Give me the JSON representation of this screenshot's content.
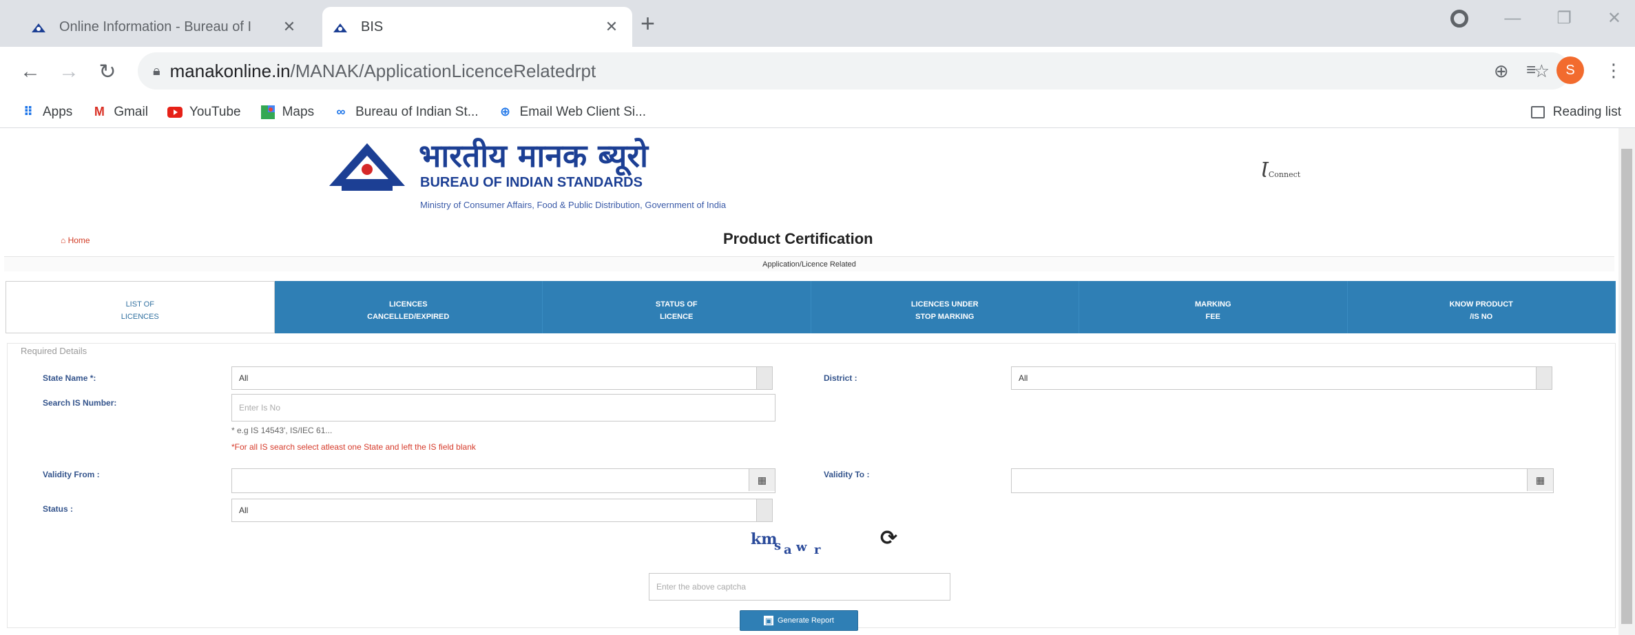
{
  "browser": {
    "tabs": [
      {
        "title": "Online Information - Bureau of I",
        "active": false
      },
      {
        "title": "BIS",
        "active": true
      }
    ],
    "url": {
      "host": "manakonline.in",
      "path": "/MANAK/ApplicationLicenceRelatedrpt"
    },
    "avatar_initial": "S",
    "bookmarks": [
      {
        "label": "Apps",
        "icon": "apps-grid-icon"
      },
      {
        "label": "Gmail",
        "icon": "gmail-icon"
      },
      {
        "label": "YouTube",
        "icon": "youtube-icon"
      },
      {
        "label": "Maps",
        "icon": "maps-icon"
      },
      {
        "label": "Bureau of Indian St...",
        "icon": "bis-icon"
      },
      {
        "label": "Email Web Client Si...",
        "icon": "globe-icon"
      }
    ],
    "reading_list": "Reading list"
  },
  "header": {
    "hindi_name": "भारतीय मानक ब्यूरो",
    "english_name": "BUREAU OF INDIAN STANDARDS",
    "ministry": "Ministry of Consumer Affairs, Food & Public Distribution, Government of India",
    "right_logo": "Ɩ",
    "right_logo_small": "Connect",
    "home": "Home",
    "title": "Product Certification",
    "subtitle": "Application/Licence Related"
  },
  "tabs": [
    {
      "line1": "LIST OF",
      "line2": "LICENCES",
      "active": true
    },
    {
      "line1": "LICENCES",
      "line2": "CANCELLED/EXPIRED",
      "active": false
    },
    {
      "line1": "STATUS OF",
      "line2": "LICENCE",
      "active": false
    },
    {
      "line1": "LICENCES UNDER",
      "line2": "STOP MARKING",
      "active": false
    },
    {
      "line1": "MARKING",
      "line2": "FEE",
      "active": false
    },
    {
      "line1": "KNOW PRODUCT",
      "line2": "/IS NO",
      "active": false
    }
  ],
  "form": {
    "legend": "Required Details",
    "state_label": "State Name *:",
    "state_value": "All",
    "district_label": "District :",
    "district_value": "All",
    "is_label": "Search IS Number:",
    "is_placeholder": "Enter Is No",
    "is_hint": "* e.g IS 14543', IS/IEC 61...",
    "is_warning": "*For all IS search select atleast one State and left the IS field blank",
    "validity_from_label": "Validity From :",
    "validity_to_label": "Validity To :",
    "status_label": "Status :",
    "status_value": "All",
    "captcha_text": "kmsawr",
    "captcha_placeholder": "Enter the above captcha",
    "generate_label": "Generate Report"
  }
}
